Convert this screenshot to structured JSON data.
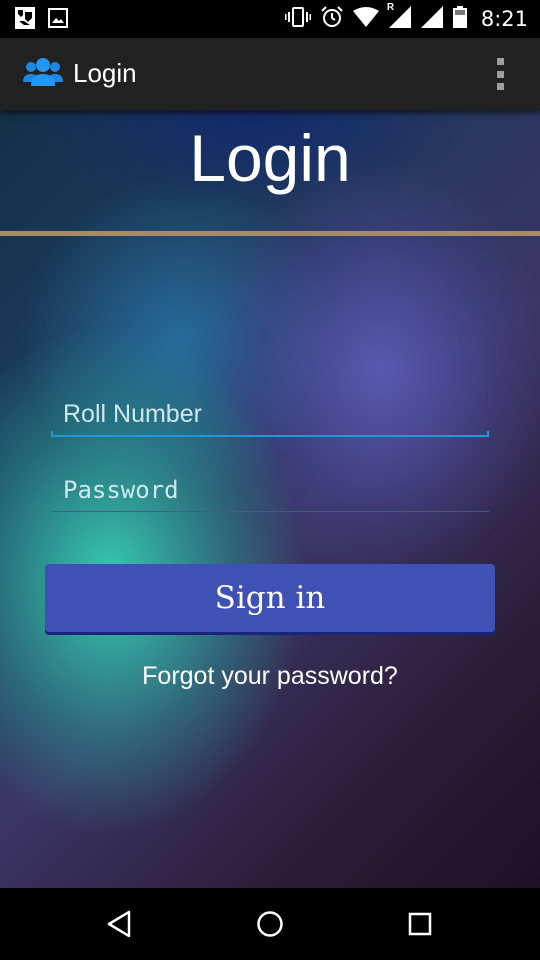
{
  "status_bar": {
    "time": "8:21",
    "left_icons": [
      "download-notification-icon",
      "image-notification-icon"
    ],
    "right_icons": [
      "vibrate-icon",
      "alarm-icon",
      "wifi-icon",
      "cell-signal-roaming-icon",
      "cell-signal-icon",
      "battery-icon"
    ],
    "roaming_label": "R"
  },
  "app_bar": {
    "title": "Login",
    "icon": "people-group-icon",
    "overflow_icon": "more-vert-icon"
  },
  "main": {
    "title": "Login",
    "roll_number_placeholder": "Roll Number",
    "password_placeholder": "Password",
    "sign_in_label": "Sign in",
    "forgot_password_label": "Forgot your password?"
  },
  "nav_bar": {
    "back_icon": "back-triangle-icon",
    "home_icon": "home-circle-icon",
    "recents_icon": "recents-square-icon"
  },
  "colors": {
    "app_bar": "#212121",
    "accent": "#2196d8",
    "button": "#3f51b5",
    "divider": "#a88a67"
  }
}
